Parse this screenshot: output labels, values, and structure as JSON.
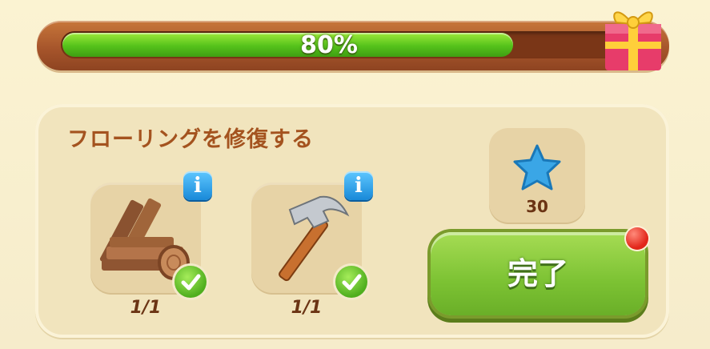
{
  "progress": {
    "percent_label": "80%",
    "fraction": 0.8
  },
  "task": {
    "title": "フローリングを修復する",
    "items": [
      {
        "icon": "wood-planks-icon",
        "count": "1/1"
      },
      {
        "icon": "hammer-icon",
        "count": "1/1"
      }
    ],
    "reward": {
      "icon": "blue-star-icon",
      "value": "30"
    },
    "complete_label": "完了"
  },
  "colors": {
    "progress_fill": "#55c21b",
    "title": "#a4531f",
    "complete_button": "#7cc233",
    "info": "#1889d8",
    "notify": "#e2261a"
  }
}
